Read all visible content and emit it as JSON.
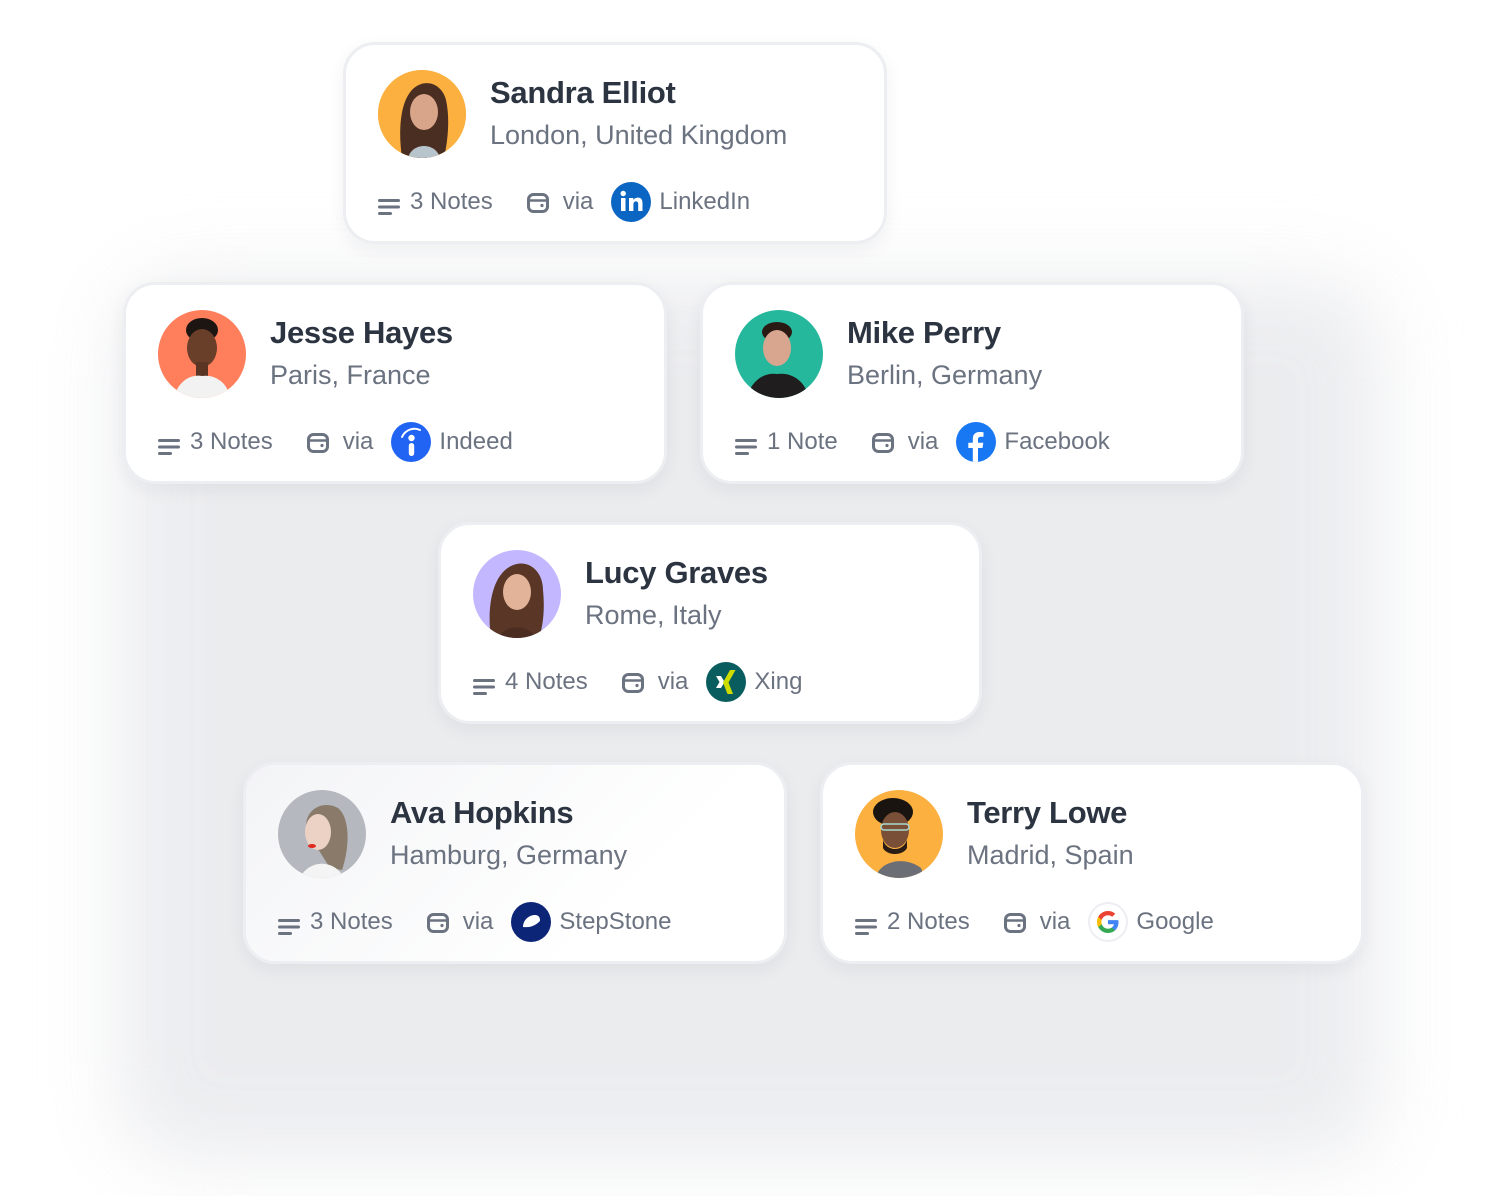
{
  "cards": [
    {
      "name": "Sandra Elliot",
      "location": "London, United Kingdom",
      "notes": "3 Notes",
      "via": "via",
      "source": "LinkedIn",
      "source_icon": "linkedin-icon",
      "source_color": "#0a66c2",
      "avatar_bg": "#fbb040"
    },
    {
      "name": "Jesse Hayes",
      "location": "Paris, France",
      "notes": "3 Notes",
      "via": "via",
      "source": "Indeed",
      "source_icon": "indeed-icon",
      "source_color": "#2164f3",
      "avatar_bg": "#ff7f5c"
    },
    {
      "name": "Mike Perry",
      "location": "Berlin, Germany",
      "notes": "1 Note",
      "via": "via",
      "source": "Facebook",
      "source_icon": "facebook-icon",
      "source_color": "#1877f2",
      "avatar_bg": "#26b89d"
    },
    {
      "name": "Lucy Graves",
      "location": "Rome, Italy",
      "notes": "4 Notes",
      "via": "via",
      "source": "Xing",
      "source_icon": "xing-icon",
      "source_color": "#0a5d5e",
      "avatar_bg": "#c3b8ff"
    },
    {
      "name": "Ava Hopkins",
      "location": "Hamburg, Germany",
      "notes": "3 Notes",
      "via": "via",
      "source": "StepStone",
      "source_icon": "stepstone-icon",
      "source_color": "#0c2577",
      "avatar_bg": "#b5b8bf"
    },
    {
      "name": "Terry Lowe",
      "location": "Madrid, Spain",
      "notes": "2 Notes",
      "via": "via",
      "source": "Google",
      "source_icon": "google-icon",
      "source_color": "#ffffff",
      "avatar_bg": "#fbb040"
    }
  ]
}
